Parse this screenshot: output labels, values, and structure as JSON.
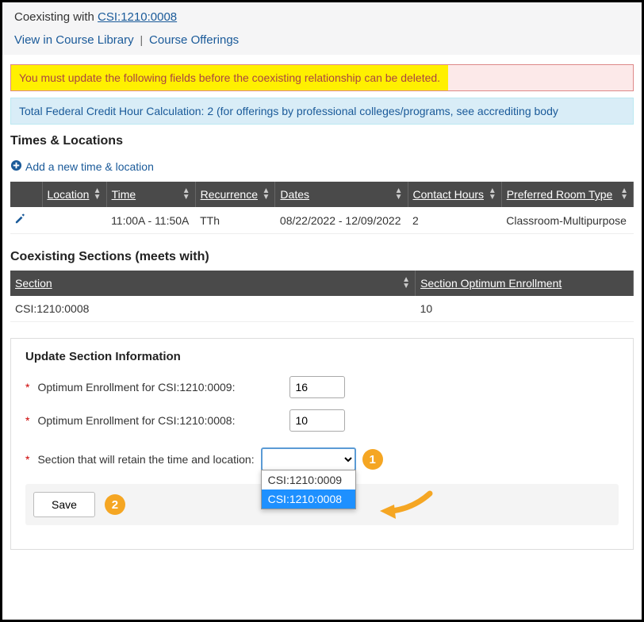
{
  "header": {
    "coexist_prefix": "Coexisting with ",
    "coexist_csi": "CSI:1210:0008",
    "view_library": "View in Course Library",
    "offerings": "Course Offerings"
  },
  "alerts": {
    "error": "You must update the following fields before the coexisting relationship can be deleted.",
    "info": "Total Federal Credit Hour Calculation: 2 (for offerings by professional colleges/programs, see accrediting body"
  },
  "times_locations": {
    "title": "Times & Locations",
    "add_label": "Add a new time & location",
    "headers": {
      "location": "Location",
      "time": "Time",
      "recurrence": "Recurrence",
      "dates": "Dates",
      "contact_hours": "Contact Hours",
      "preferred_room": "Preferred Room Type"
    },
    "rows": [
      {
        "location": "",
        "time": "11:00A - 11:50A",
        "recurrence": "TTh",
        "dates": "08/22/2022 - 12/09/2022",
        "contact_hours": "2",
        "preferred_room": "Classroom-Multipurpose"
      }
    ]
  },
  "coexisting": {
    "title": "Coexisting Sections (meets with)",
    "headers": {
      "section": "Section",
      "optimum": "Section Optimum Enrollment"
    },
    "rows": [
      {
        "section": "CSI:1210:0008",
        "optimum": "10"
      }
    ]
  },
  "update_panel": {
    "title": "Update Section Information",
    "opt_label_1": "Optimum Enrollment for CSI:1210:0009:",
    "opt_val_1": "16",
    "opt_label_2": "Optimum Enrollment for CSI:1210:0008:",
    "opt_val_2": "10",
    "retain_label": "Section that will retain the time and location:",
    "retain_selected": "",
    "retain_options": [
      "CSI:1210:0009",
      "CSI:1210:0008"
    ],
    "retain_highlighted": "CSI:1210:0008",
    "save_label": "Save"
  },
  "callouts": {
    "one": "1",
    "two": "2"
  }
}
